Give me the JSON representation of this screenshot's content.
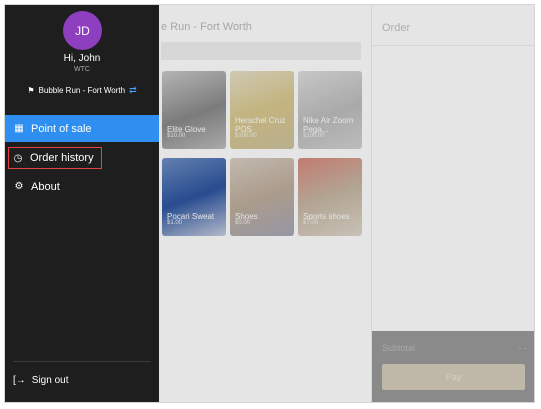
{
  "user": {
    "initials": "JD",
    "greeting": "Hi, John",
    "org": "WTC",
    "location": "Bubble Run - Fort Worth"
  },
  "nav": {
    "point_of_sale": "Point of sale",
    "order_history": "Order history",
    "about": "About",
    "sign_out": "Sign out"
  },
  "main": {
    "store_title": "e Run - Fort Worth",
    "products": [
      {
        "name": "Elite Glove",
        "price": "$10.00"
      },
      {
        "name": "Herschel Cruz POS",
        "price": "$100.00"
      },
      {
        "name": "Nike Air Zoom Pega...",
        "price": "$100.00"
      },
      {
        "name": "Pocari Sweat",
        "price": "$1.00"
      },
      {
        "name": "Shoes",
        "price": "$0.00"
      },
      {
        "name": "Sports shoes",
        "price": "$7.00"
      }
    ]
  },
  "order": {
    "title": "Order",
    "subtotal_label": "Subtotal",
    "subtotal_value": "- -",
    "pay_label": "Pay"
  },
  "colors": {
    "drawer_bg": "#1e1e1e",
    "active_item": "#2e8ff0",
    "avatar": "#8e3fbf",
    "highlight_border": "#e0443f",
    "pay_button": "#d5ccbb"
  }
}
